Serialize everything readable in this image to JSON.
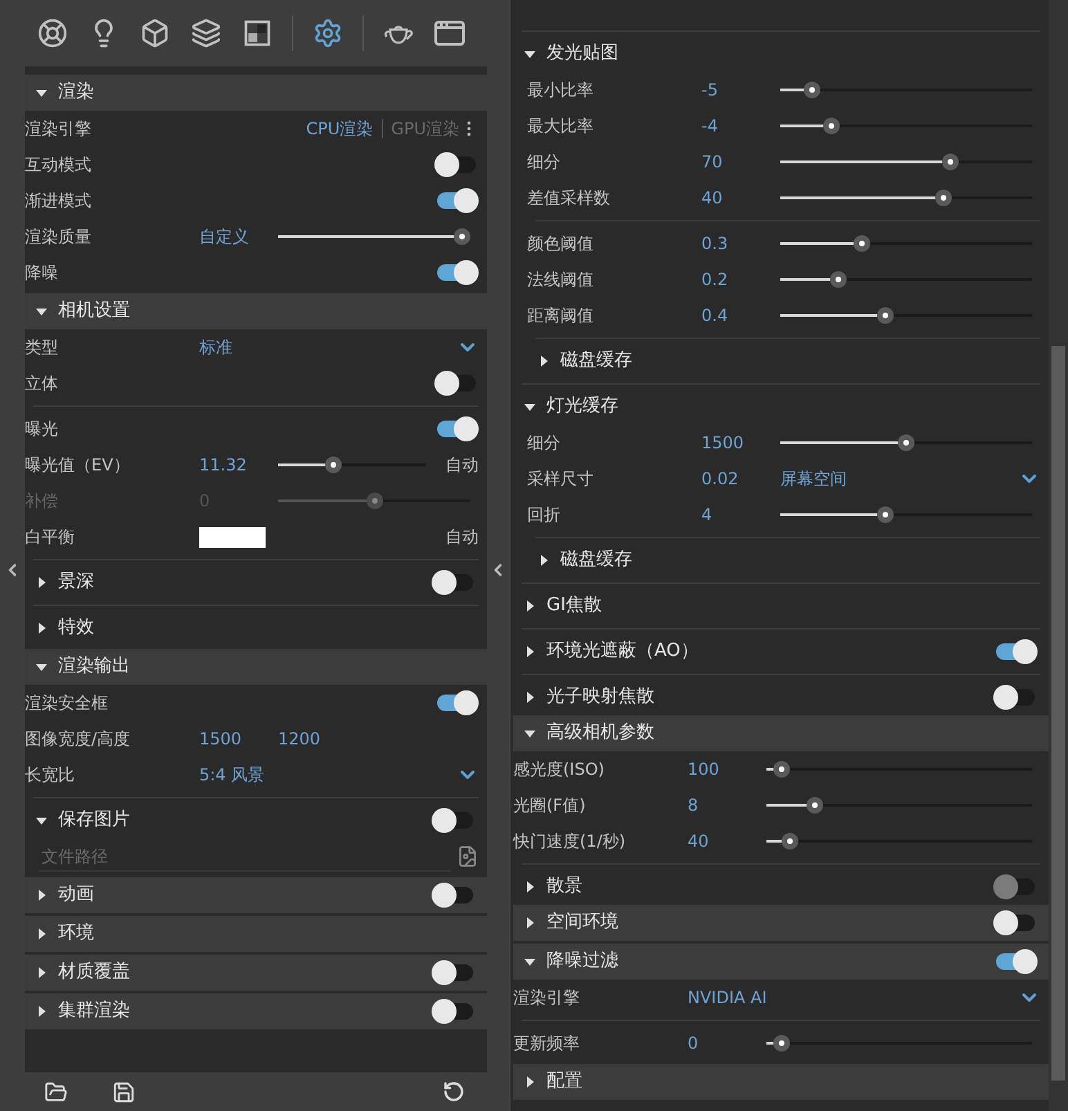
{
  "toolbar": {
    "tools": [
      {
        "selected": false
      },
      {
        "selected": false
      },
      {
        "selected": false
      },
      {
        "selected": false
      },
      {
        "selected": false
      },
      {
        "selected": true
      },
      {
        "selected": false
      },
      {
        "selected": false
      }
    ]
  },
  "left": {
    "rows": [
      {
        "kind": "section",
        "shaded": true,
        "title": "渲染",
        "expanded": true,
        "children": [
          {
            "kind": "engine",
            "label": "渲染引擎",
            "options": [
              {
                "label": "CPU渲染",
                "selected": true
              },
              {
                "label": "GPU渲染",
                "selected": false
              }
            ]
          },
          {
            "kind": "toggle",
            "label": "互动模式",
            "on": false
          },
          {
            "kind": "toggle",
            "label": "渐进模式",
            "on": true
          },
          {
            "kind": "slider",
            "label": "渲染质量",
            "value": "自定义",
            "level": 1
          },
          {
            "kind": "toggle",
            "label": "降噪",
            "on": true
          }
        ]
      },
      {
        "kind": "section",
        "shaded": true,
        "title": "相机设置",
        "expanded": true,
        "children": [
          {
            "kind": "dropdown",
            "label": "类型",
            "value": "标准"
          },
          {
            "kind": "toggle",
            "label": "立体",
            "on": false
          },
          {
            "kind": "divider"
          },
          {
            "kind": "toggle",
            "label": "曝光",
            "on": true
          },
          {
            "kind": "slider",
            "label": "曝光值（EV）",
            "value": "11.32",
            "level": 0.36,
            "note": "自动",
            "disabled": false
          },
          {
            "kind": "slider",
            "label": "补偿",
            "value": "0",
            "level": 0.5,
            "disabled": true
          },
          {
            "kind": "swatch",
            "label": "白平衡",
            "color": "#ffffff",
            "note": "自动"
          },
          {
            "kind": "divider"
          },
          {
            "kind": "section",
            "shaded": false,
            "title": "景深",
            "expanded": false,
            "on": false
          },
          {
            "kind": "divider"
          },
          {
            "kind": "section",
            "shaded": false,
            "title": "特效",
            "expanded": false
          }
        ]
      },
      {
        "kind": "section",
        "shaded": true,
        "title": "渲染输出",
        "expanded": true,
        "children": [
          {
            "kind": "toggle",
            "label": "渲染安全框",
            "on": true
          },
          {
            "kind": "pair",
            "label": "图像宽度/高度",
            "values": [
              "1500",
              "1200"
            ]
          },
          {
            "kind": "dropdown",
            "label": "长宽比",
            "value": "5:4 风景"
          },
          {
            "kind": "divider"
          },
          {
            "kind": "section",
            "shaded": false,
            "title": "保存图片",
            "expanded": true,
            "on": false,
            "children": [
              {
                "kind": "file",
                "placeholder": "文件路径"
              }
            ]
          }
        ]
      },
      {
        "kind": "section",
        "shaded": true,
        "title": "动画",
        "expanded": false,
        "on": false
      },
      {
        "kind": "section",
        "shaded": true,
        "title": "环境",
        "expanded": false
      },
      {
        "kind": "section",
        "shaded": true,
        "title": "材质覆盖",
        "expanded": false,
        "on": false
      },
      {
        "kind": "section",
        "shaded": true,
        "title": "集群渲染",
        "expanded": false,
        "on": false
      }
    ]
  },
  "right": {
    "rows": [
      {
        "kind": "divider"
      },
      {
        "kind": "section",
        "shaded": false,
        "title": "发光贴图",
        "expanded": true,
        "children": [
          {
            "kind": "slider",
            "label": "最小比率",
            "value": "-5",
            "level": 0.1
          },
          {
            "kind": "slider",
            "label": "最大比率",
            "value": "-4",
            "level": 0.18
          },
          {
            "kind": "slider",
            "label": "细分",
            "value": "70",
            "level": 0.69
          },
          {
            "kind": "slider",
            "label": "差值采样数",
            "value": "40",
            "level": 0.66
          },
          {
            "kind": "divider"
          },
          {
            "kind": "slider",
            "label": "颜色阈值",
            "value": "0.3",
            "level": 0.31
          },
          {
            "kind": "slider",
            "label": "法线阈值",
            "value": "0.2",
            "level": 0.21
          },
          {
            "kind": "slider",
            "label": "距离阈值",
            "value": "0.4",
            "level": 0.41
          },
          {
            "kind": "divider"
          },
          {
            "kind": "section",
            "shaded": false,
            "title": "磁盘缓存",
            "expanded": false
          }
        ]
      },
      {
        "kind": "divider"
      },
      {
        "kind": "section",
        "shaded": false,
        "title": "灯光缓存",
        "expanded": true,
        "children": [
          {
            "kind": "slider",
            "label": "细分",
            "value": "1500",
            "level": 0.5
          },
          {
            "kind": "value_dropdown",
            "label": "采样尺寸",
            "value": "0.02",
            "option": "屏幕空间"
          },
          {
            "kind": "slider",
            "label": "回折",
            "value": "4",
            "level": 0.41
          },
          {
            "kind": "divider"
          },
          {
            "kind": "section",
            "shaded": false,
            "title": "磁盘缓存",
            "expanded": false
          }
        ]
      },
      {
        "kind": "divider"
      },
      {
        "kind": "section",
        "shaded": false,
        "title": "GI焦散",
        "expanded": false
      },
      {
        "kind": "divider"
      },
      {
        "kind": "section",
        "shaded": false,
        "title": "环境光遮蔽（AO）",
        "expanded": false,
        "on": true
      },
      {
        "kind": "divider"
      },
      {
        "kind": "section",
        "shaded": false,
        "title": "光子映射焦散",
        "expanded": false,
        "on": false
      },
      {
        "kind": "section",
        "shaded": true,
        "title": "高级相机参数",
        "expanded": true,
        "children": [
          {
            "kind": "slider",
            "label": "感光度(ISO)",
            "value": "100",
            "level": 0.03
          },
          {
            "kind": "slider",
            "label": "光圈(F值)",
            "value": "8",
            "level": 0.16
          },
          {
            "kind": "slider",
            "label": "快门速度(1/秒)",
            "value": "40",
            "level": 0.06
          }
        ]
      },
      {
        "kind": "divider"
      },
      {
        "kind": "section",
        "shaded": false,
        "title": "散景",
        "expanded": false,
        "on": false,
        "disabled": true
      },
      {
        "kind": "section",
        "shaded": true,
        "title": "空间环境",
        "expanded": false,
        "on": false
      },
      {
        "kind": "section",
        "shaded": true,
        "title": "降噪过滤",
        "expanded": true,
        "on": true,
        "children": [
          {
            "kind": "dropdown",
            "label": "渲染引擎",
            "value": "NVIDIA AI"
          },
          {
            "kind": "divider"
          },
          {
            "kind": "slider",
            "label": "更新频率",
            "value": "0",
            "level": 0.03
          }
        ]
      },
      {
        "kind": "section",
        "shaded": true,
        "title": "配置",
        "expanded": false
      }
    ]
  }
}
